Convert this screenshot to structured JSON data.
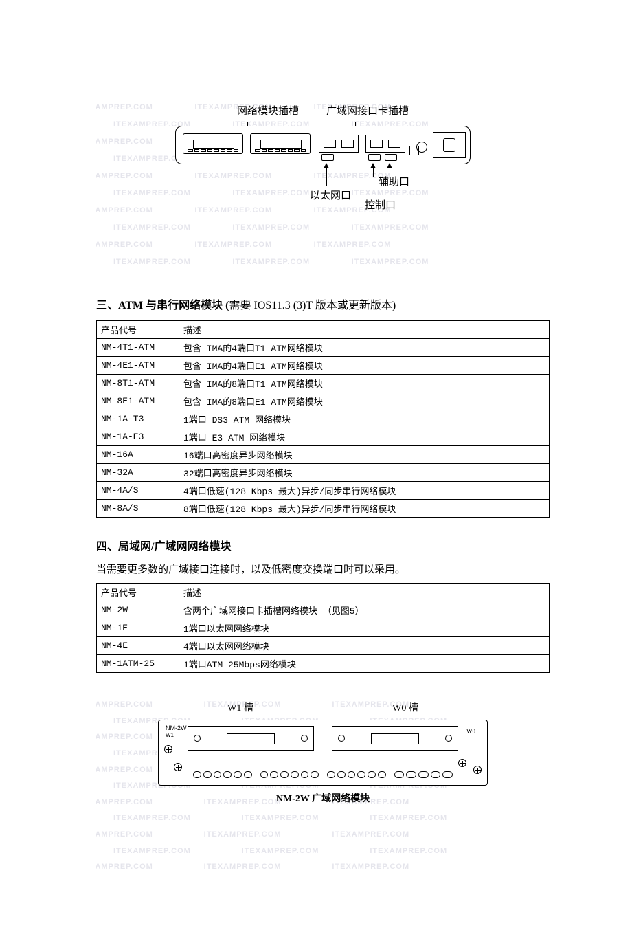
{
  "figure1": {
    "top_labels": {
      "left": "网络模块插槽",
      "right": "广域网接口卡插槽"
    },
    "bottom_labels": {
      "eth": "以太网口",
      "aux": "辅助口",
      "con": "控制口"
    }
  },
  "section3": {
    "heading_prefix": "三、",
    "heading_bold": "ATM 与串行网络模块 (",
    "heading_suffix": "需要 IOS11.3 (3)T 版本或更新版本)",
    "headers": {
      "code": "产品代号",
      "desc": "描述"
    },
    "rows": [
      {
        "code": "NM-4T1-ATM",
        "desc": "包含 IMA的4端口T1 ATM网络模块"
      },
      {
        "code": "NM-4E1-ATM",
        "desc": "包含 IMA的4端口E1 ATM网络模块"
      },
      {
        "code": "NM-8T1-ATM",
        "desc": "包含 IMA的8端口T1 ATM网络模块"
      },
      {
        "code": "NM-8E1-ATM",
        "desc": "包含 IMA的8端口E1 ATM网络模块"
      },
      {
        "code": "NM-1A-T3",
        "desc": "1端口 DS3 ATM 网络模块"
      },
      {
        "code": "NM-1A-E3",
        "desc": "1端口 E3 ATM 网络模块"
      },
      {
        "code": "NM-16A",
        "desc": "16端口高密度异步网络模块"
      },
      {
        "code": "NM-32A",
        "desc": "32端口高密度异步网络模块"
      },
      {
        "code": "NM-4A/S",
        "desc": "4端口低速(128 Kbps 最大)异步/同步串行网络模块"
      },
      {
        "code": "NM-8A/S",
        "desc": "8端口低速(128 Kbps 最大)异步/同步串行网络模块"
      }
    ]
  },
  "section4": {
    "heading": "四、局域网/广域网网络模块",
    "desc": "当需要更多数的广域接口连接时，以及低密度交换端口时可以采用。",
    "headers": {
      "code": "产品代号",
      "desc": "描述"
    },
    "rows": [
      {
        "code": "NM-2W",
        "desc": "含两个广域网接口卡插槽网络模块 （见图5）"
      },
      {
        "code": "NM-1E",
        "desc": "1端口以太网网络模块"
      },
      {
        "code": "NM-4E",
        "desc": "4端口以太网网络模块"
      },
      {
        "code": "NM-1ATM-25",
        "desc": "1端口ATM 25Mbps网络模块"
      }
    ]
  },
  "figure2": {
    "slot_left": "W1 槽",
    "slot_right": "W0 槽",
    "tag_left": "W1",
    "tag_right": "W0",
    "box_label": "NM-2W",
    "caption": "NM-2W 广域网络模块"
  },
  "watermark_text": "ITEXAMPREP.COM"
}
